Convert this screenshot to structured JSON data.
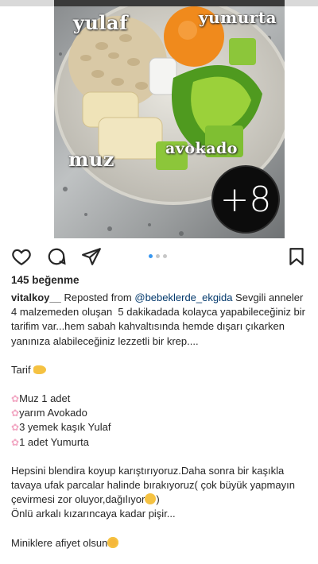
{
  "photo": {
    "labels": {
      "yulaf": "yulaf",
      "yumurta": "yumurta",
      "muz": "muz",
      "avokado": "avokado"
    },
    "badge": "+8"
  },
  "actions": {
    "icons": [
      "heart-icon",
      "comment-icon",
      "share-icon",
      "bookmark-icon"
    ],
    "carousel_dots": 3,
    "carousel_active": 1,
    "accent_color": "#3897f0"
  },
  "post": {
    "likes": "145 beğenme",
    "username": "vitalkoy__",
    "reposted_prefix": " Reposted from ",
    "reposted_user": "@bebeklerde_ekgida",
    "caption_intro": " Sevgili anneler 4 malzemeden oluşan  5 dakikadada kolayca yapabileceğiniz bir tarifim var...hem sabah kahvaltısında hemde dışarı çıkarken yanınıza alabileceğiniz lezzetli bir krep....",
    "recipe_title": "Tarif",
    "ingredients": [
      "Muz 1 adet",
      "yarım Avokado",
      "3 yemek kaşık Yulaf",
      "1 adet Yumurta"
    ],
    "instructions_1": "Hepsini blendira koyup karıştırıyoruz.Daha sonra bir kaşıkla tavaya ufak parcalar halinde bırakıyoruz( çok büyük yapmayın çevirmesi zor oluyor,dağılıyor",
    "instructions_2": "Önlü arkalı kızarıncaya kadar pişir...",
    "closing": "Miniklere afiyet olsun"
  }
}
